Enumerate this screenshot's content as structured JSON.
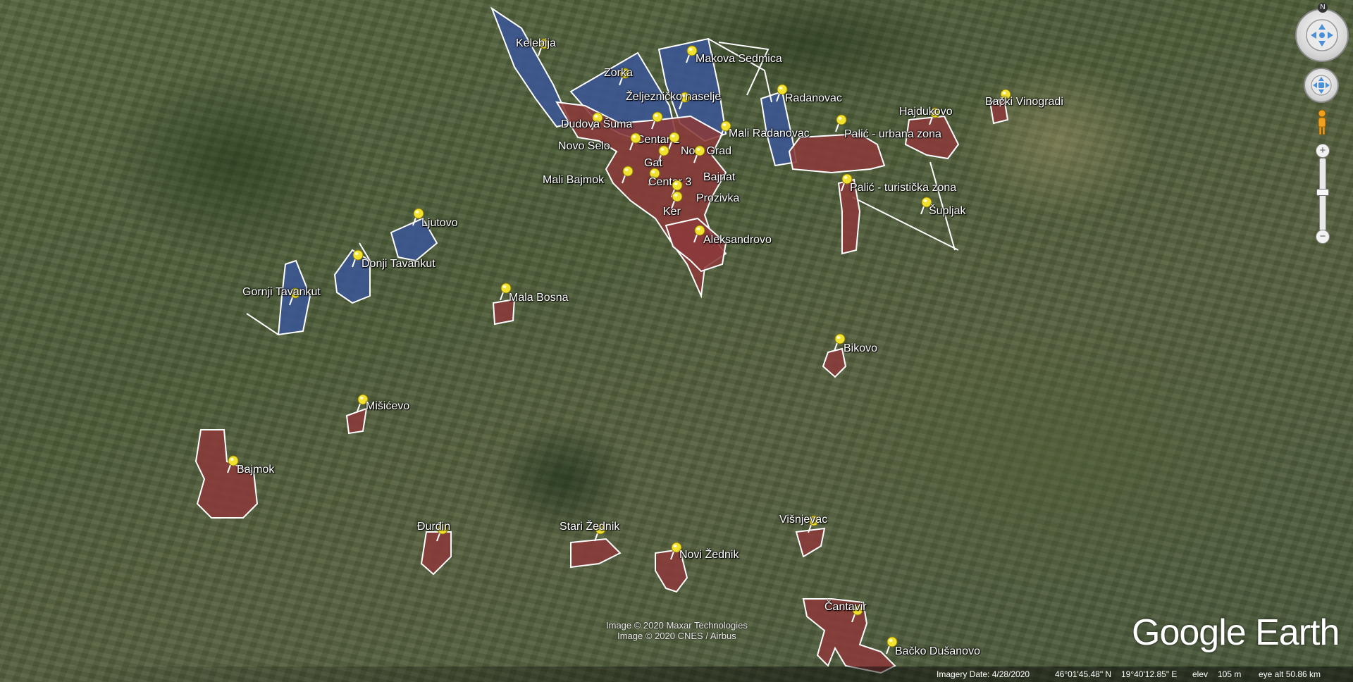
{
  "map": {
    "places": [
      {
        "name": "Kelebija",
        "type": "pin"
      },
      {
        "name": "Zorka",
        "type": "pin"
      },
      {
        "name": "Makova Sedmica",
        "type": "pin"
      },
      {
        "name": "Željezničko naselje",
        "type": "pin"
      },
      {
        "name": "Radanovac",
        "type": "pin"
      },
      {
        "name": "Hajdukovo",
        "type": "pin"
      },
      {
        "name": "Bački Vinogradi",
        "type": "pin"
      },
      {
        "name": "Dudova Šuma",
        "type": "pin"
      },
      {
        "name": "Centar 2",
        "type": "pin"
      },
      {
        "name": "Mali Radanovac",
        "type": "pin"
      },
      {
        "name": "Palić - urbana zona",
        "type": "pin"
      },
      {
        "name": "Novo Selo",
        "type": "pin"
      },
      {
        "name": "Novi Grad",
        "type": "pin"
      },
      {
        "name": "Gat",
        "type": "pin"
      },
      {
        "name": "Mali Bajmok",
        "type": "pin"
      },
      {
        "name": "Centar 3",
        "type": "pin"
      },
      {
        "name": "Bajnat",
        "type": "pin"
      },
      {
        "name": "Palić - turistička zona",
        "type": "pin"
      },
      {
        "name": "Prozivka",
        "type": "pin"
      },
      {
        "name": "Ker",
        "type": "pin"
      },
      {
        "name": "Šupljak",
        "type": "pin"
      },
      {
        "name": "Ljutovo",
        "type": "pin"
      },
      {
        "name": "Aleksandrovo",
        "type": "pin"
      },
      {
        "name": "Donji Tavankut",
        "type": "pin"
      },
      {
        "name": "Gornji Tavankut",
        "type": "pin"
      },
      {
        "name": "Mala Bosna",
        "type": "pin"
      },
      {
        "name": "Bikovo",
        "type": "pin"
      },
      {
        "name": "Mišićevo",
        "type": "pin"
      },
      {
        "name": "Bajmok",
        "type": "pin"
      },
      {
        "name": "Đurđin",
        "type": "pin"
      },
      {
        "name": "Stari Žednik",
        "type": "pin"
      },
      {
        "name": "Višnjevac",
        "type": "pin"
      },
      {
        "name": "Novi Žednik",
        "type": "pin"
      },
      {
        "name": "Čantavir",
        "type": "pin"
      },
      {
        "name": "Bačko Dušanovo",
        "type": "pin"
      }
    ],
    "attribution": [
      "Image © 2020 Maxar Technologies",
      "Image © 2020 CNES / Airbus"
    ],
    "logo": "Google Earth",
    "colors": {
      "red_zone": "#8b3a3a",
      "blue_zone": "#3b5699",
      "zone_outline": "#ffffff",
      "pin": "#f2e230"
    }
  },
  "status": {
    "imagery_date": "Imagery Date: 4/28/2020",
    "lat": "46°01'45.48\" N",
    "lon": "19°40'12.85\" E",
    "elev_label": "elev",
    "elev": "105 m",
    "eye_alt": "eye alt  50.86 km"
  },
  "controls": {
    "compass_letter": "N",
    "zoom_in": "+",
    "zoom_out": "−",
    "street_view_icon": "pegman-icon"
  }
}
